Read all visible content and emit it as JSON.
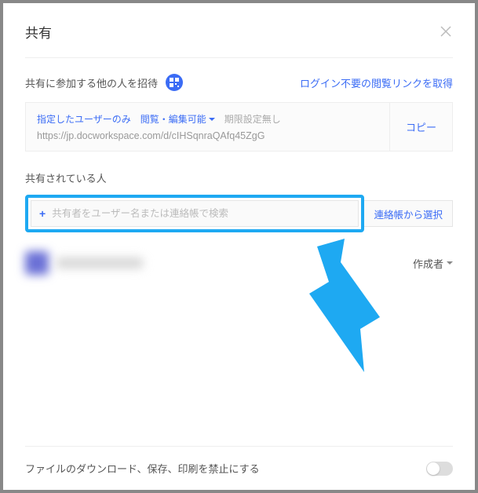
{
  "dialog": {
    "title": "共有",
    "invite_text": "共有に参加する他の人を招待",
    "get_link_text": "ログイン不要の閲覧リンクを取得",
    "url_box": {
      "scope": "指定したユーザーのみ",
      "permission": "閲覧・編集可能",
      "expiry": "期限設定無し",
      "url": "https://jp.docworkspace.com/d/cIHSqnraQAfq45ZgG",
      "copy_label": "コピー"
    },
    "shared_label": "共有されている人",
    "search": {
      "placeholder": "共有者をユーザー名または連絡帳で検索",
      "contacts_btn": "連絡帳から選択"
    },
    "users": [
      {
        "role": "作成者"
      }
    ],
    "footer": {
      "restrict_label": "ファイルのダウンロード、保存、印刷を禁止にする",
      "toggle_on": false
    }
  },
  "colors": {
    "accent": "#3b6cf5",
    "highlight": "#1ea9f2"
  }
}
